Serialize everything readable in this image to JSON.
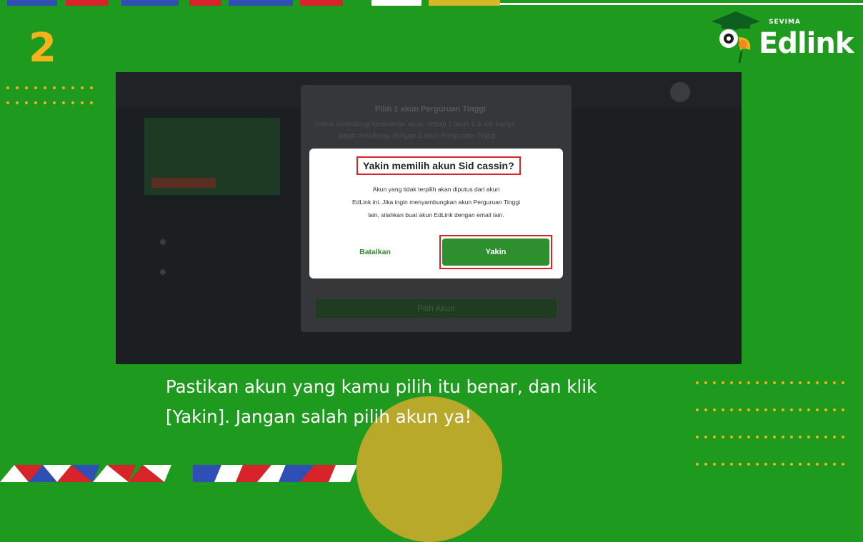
{
  "step_number": "2",
  "brand": {
    "name": "Edlink",
    "company": "SEVIMA"
  },
  "background_screen": {
    "modal_title": "Pilih 1 akun Perguruan Tinggi",
    "modal_desc_line1": "Untuk melindungi keamanan akun, setiap 1 akun EdLink hanya",
    "modal_desc_line2": "dapat terhubung dengan 1 akun Perguruan Tinggi",
    "select_button": "Pilih Akun"
  },
  "dialog": {
    "title": "Yakin memilih akun Sid cassin?",
    "body_line1": "Akun yang tidak terpilih akan diputus dari akun",
    "body_line2": "EdLink ini. Jika ingin menyambungkan akun Perguruan Tinggi",
    "body_line3": "lain, silahkan buat akun EdLink dengan email lain.",
    "cancel_label": "Batalkan",
    "confirm_label": "Yakin"
  },
  "caption": {
    "line1": "Pastikan akun yang kamu pilih itu benar, dan klik",
    "line2": "[Yakin]. Jangan salah pilih akun ya!"
  },
  "colors": {
    "background": "#1e9a1e",
    "accent": "#f5b21c",
    "highlight": "#d8232a",
    "primary_button": "#2e8f2e"
  }
}
